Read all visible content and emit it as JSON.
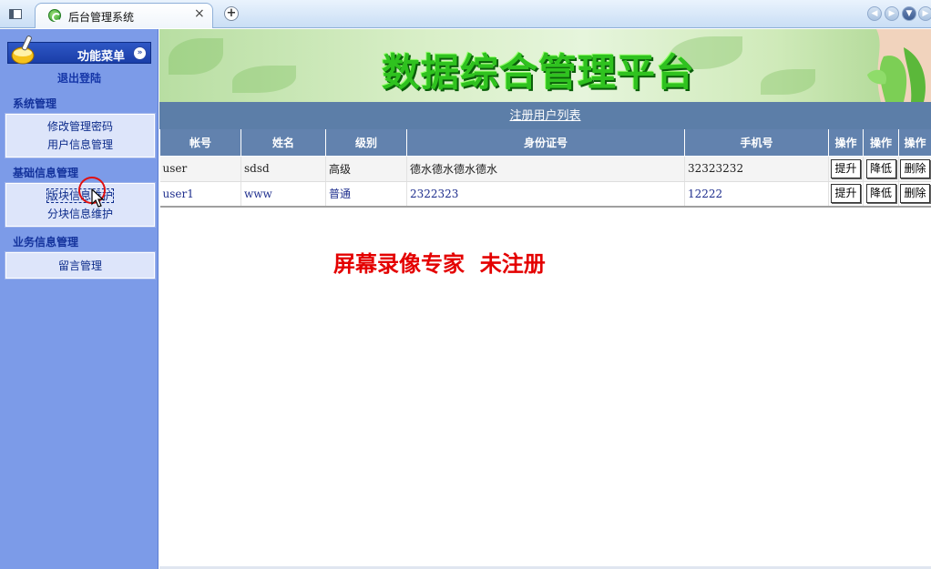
{
  "browser": {
    "tab_title": "后台管理系统",
    "tab_close": "×",
    "new_tab": "+"
  },
  "sidebar": {
    "menu_title": "功能菜单",
    "menu_toggle": "»",
    "logout": "退出登陆",
    "groups": [
      {
        "title": "系统管理",
        "items": [
          "修改管理密码",
          "用户信息管理"
        ]
      },
      {
        "title": "基础信息管理",
        "items": [
          "版块信息维护",
          "分块信息维护"
        ]
      },
      {
        "title": "业务信息管理",
        "items": [
          "留言管理"
        ]
      }
    ]
  },
  "banner": {
    "title": "数据综合管理平台"
  },
  "content": {
    "list_title": "注册用户列表",
    "columns": [
      "帐号",
      "姓名",
      "级别",
      "身份证号",
      "手机号",
      "操作",
      "操作",
      "操作"
    ],
    "rows": [
      {
        "account": "user",
        "name": "sdsd",
        "level": "高级",
        "id_number": "德水德水德水德水",
        "phone": "32323232",
        "actions": [
          "提升",
          "降低",
          "删除"
        ]
      },
      {
        "account": "user1",
        "name": "www",
        "level": "普通",
        "id_number": "2322323",
        "phone": "12222",
        "actions": [
          "提升",
          "降低",
          "删除"
        ]
      }
    ]
  },
  "watermark": "屏幕录像专家  未注册",
  "colors": {
    "sidebar_bg": "#7c9be8",
    "header_bar": "#5c7ea8",
    "banner_title": "#2fc21f",
    "watermark": "#e40000"
  }
}
